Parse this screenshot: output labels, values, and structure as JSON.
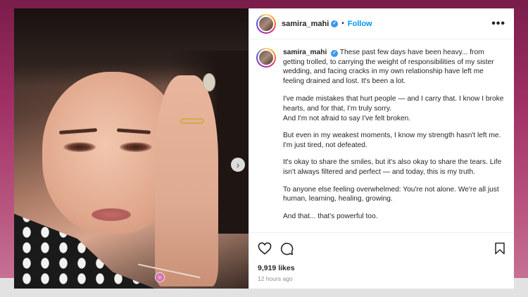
{
  "post": {
    "username": "samira_mahi",
    "follow_label": "Follow",
    "more_label": "•••",
    "separator": "•",
    "verified_mark": "✓",
    "carousel_next": "›",
    "caption": {
      "intro": "These past few days have been heavy... from getting trolled, to carrying the weight of responsibilities of my sister wedding, and facing cracks in my own relationship have left me feeling drained and lost. It's been a lot.",
      "p2": "I've made mistakes that hurt people — and I carry that. I know I broke hearts, and for that, I'm truly sorry.",
      "p2b": "And I'm not afraid to say I've felt broken.",
      "p3": "But even in my weakest moments, I know my strength hasn't left me. I'm just tired, not defeated.",
      "p4": "It's okay to share the smiles, but it's also okay to share the tears. Life isn't always filtered and perfect — and today, this is my truth.",
      "p5": "To anyone else feeling overwhelmed: You're not alone. We're all just human, learning, healing, growing.",
      "p6": "And that... that's powerful too."
    },
    "likes": "9,919 likes",
    "time": "12 hours ago"
  },
  "icons": [
    "heart-icon",
    "comment-icon",
    "bookmark-icon",
    "verified-badge-icon",
    "more-icon",
    "chevron-right-icon"
  ],
  "colors": {
    "accent": "#0095f6",
    "verified": "#3897f0",
    "text": "#262626",
    "muted": "#8e8e8e"
  }
}
